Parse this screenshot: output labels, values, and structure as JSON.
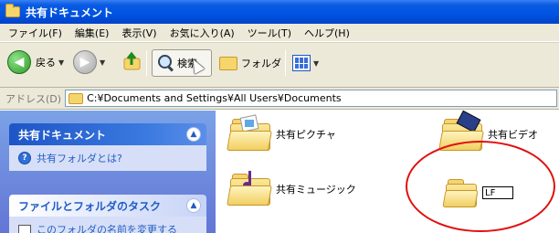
{
  "window": {
    "title": "共有ドキュメント"
  },
  "menu": [
    "ファイル(F)",
    "編集(E)",
    "表示(V)",
    "お気に入り(A)",
    "ツール(T)",
    "ヘルプ(H)"
  ],
  "toolbar": {
    "back_label": "戻る",
    "search_label": "検索",
    "folders_label": "フォルダ"
  },
  "address": {
    "label": "アドレス(D)",
    "path": "C:¥Documents and Settings¥All Users¥Documents"
  },
  "left_panel": {
    "section1_title": "共有ドキュメント",
    "section1_link": "共有フォルダとは?",
    "section2_title": "ファイルとフォルダのタスク",
    "section2_link": "このフォルダの名前を変更する"
  },
  "files": [
    {
      "name": "共有ピクチャ",
      "icon": "pictures-folder-icon"
    },
    {
      "name": "共有ビデオ",
      "icon": "videos-folder-icon"
    },
    {
      "name": "共有ミュージック",
      "icon": "music-folder-icon"
    }
  ],
  "rename_item": {
    "value": "LF",
    "icon": "folder-icon"
  },
  "colors": {
    "title_bar": "#0053e1",
    "annotation": "#e01010",
    "task_link": "#215dc6"
  }
}
